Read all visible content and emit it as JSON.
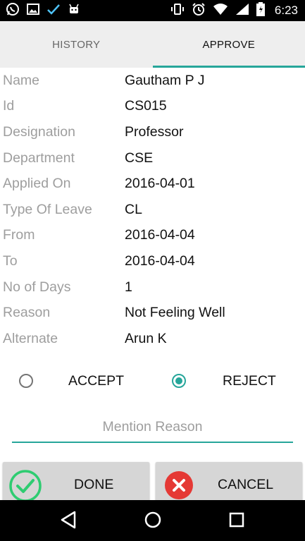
{
  "status_bar": {
    "time": "6:23",
    "left_icons": [
      "whatsapp-icon",
      "image-icon",
      "check-icon",
      "android-icon"
    ],
    "right_icons": [
      "vibrate-icon",
      "alarm-icon",
      "wifi-icon",
      "signal-icon",
      "battery-icon"
    ]
  },
  "tabs": [
    {
      "label": "HISTORY",
      "selected": false
    },
    {
      "label": "APPROVE",
      "selected": true
    }
  ],
  "details": [
    {
      "label": "Name",
      "value": "Gautham P J"
    },
    {
      "label": "Id",
      "value": "CS015"
    },
    {
      "label": "Designation",
      "value": "Professor"
    },
    {
      "label": "Department",
      "value": "CSE"
    },
    {
      "label": "Applied On",
      "value": "2016-04-01"
    },
    {
      "label": "Type Of Leave",
      "value": "CL"
    },
    {
      "label": "From",
      "value": "2016-04-04"
    },
    {
      "label": "To",
      "value": "2016-04-04"
    },
    {
      "label": "No of Days",
      "value": "1"
    },
    {
      "label": "Reason",
      "value": "Not Feeling Well"
    },
    {
      "label": "Alternate",
      "value": "Arun K"
    }
  ],
  "decision": {
    "accept_label": "ACCEPT",
    "reject_label": "REJECT",
    "selected": "reject"
  },
  "reason_field": {
    "placeholder": "Mention Reason",
    "value": ""
  },
  "buttons": {
    "done_label": "DONE",
    "cancel_label": "CANCEL"
  },
  "colors": {
    "accent": "#26a69a",
    "done_icon": "#2ecc71",
    "cancel_icon": "#e53935"
  },
  "nav_bar": {
    "icons": [
      "back-icon",
      "home-icon",
      "recents-icon"
    ]
  }
}
